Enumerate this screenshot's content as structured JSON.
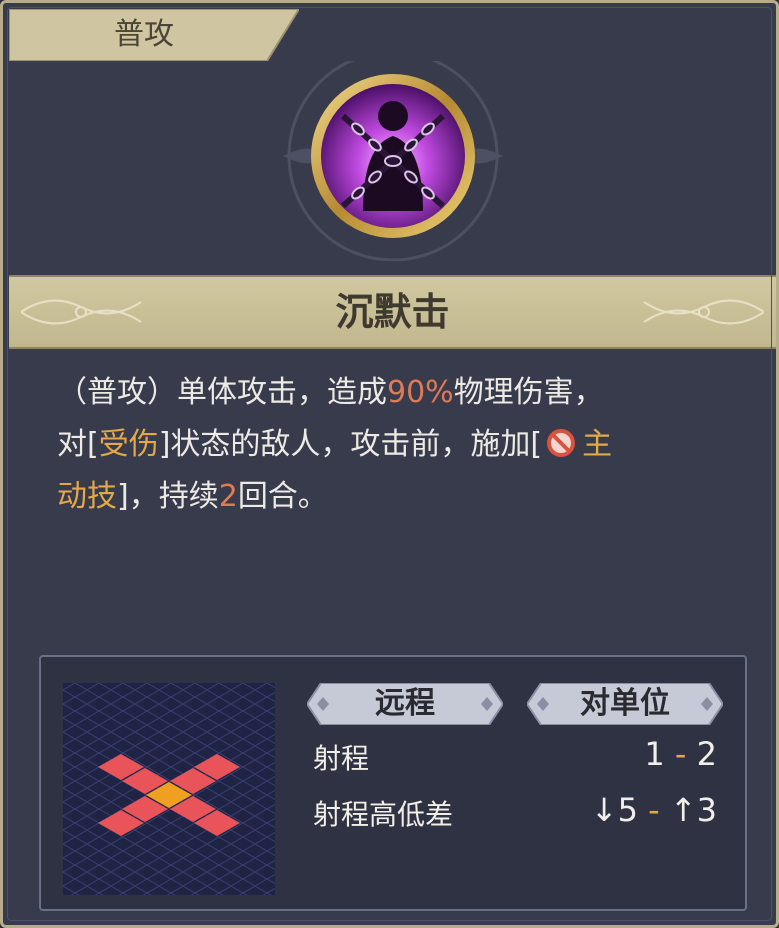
{
  "tab": {
    "label": "普攻"
  },
  "skill": {
    "icon": "chained-silhouette-icon",
    "name": "沉默击"
  },
  "description": {
    "line1_prefix": "（普攻）单体攻击，造成",
    "damage_pct": "90%",
    "line1_suffix": "物理伤害，",
    "line2_prefix": "对[",
    "status": "受伤",
    "line2_mid": "]状态的敌人，攻击前，施加[",
    "debuff_icon": "forbidden-icon",
    "debuff_part1": "主",
    "debuff_part2": "动技",
    "line3_mid": "]，持续",
    "duration": "2",
    "line3_suffix": "回合。"
  },
  "info": {
    "attack_type": "远程",
    "target_type": "对单位",
    "range_label": "射程",
    "range_min": "1",
    "range_sep": "-",
    "range_max": "2",
    "height_label": "射程高低差",
    "height_down": "5",
    "height_up": "3"
  },
  "colors": {
    "accent_orange": "#e07a55",
    "accent_gold": "#e3a84a",
    "range_tile": "#e8545a",
    "center_tile": "#f0a020"
  }
}
